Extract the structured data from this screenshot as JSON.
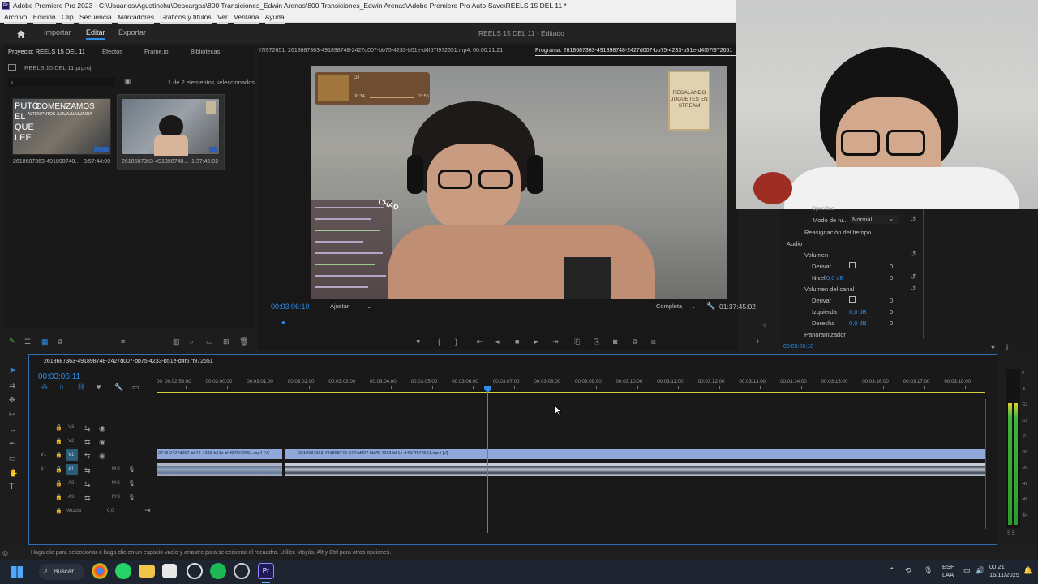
{
  "window": {
    "title": "Adobe Premiere Pro 2023 - C:\\Usuarios\\Agustinchu\\Descargas\\800 Transiciones_Edwin Arenas\\800 Transiciones_Edwin Arenas\\Adobe Premiere Pro Auto-Save\\REELS 15 DEL 11 *",
    "controls": "—"
  },
  "menu": [
    "Archivo",
    "Edición",
    "Clip",
    "Secuencia",
    "Marcadores",
    "Gráficos y títulos",
    "Ver",
    "Ventana",
    "Ayuda"
  ],
  "workspaces": {
    "tabs": [
      "Importar",
      "Editar",
      "Exportar"
    ],
    "active": "Editar",
    "project_title": "REELS 15 DEL 11 - Editado"
  },
  "project": {
    "tabs": [
      "Proyecto: REELS 15 DEL 11",
      "Efectos",
      "Frame.io",
      "Bibliotecas"
    ],
    "file": "REELS 15 DEL 11.prproj",
    "selection": "1 de 2 elementos seleccionados",
    "items": [
      {
        "name": "2618687363-491898748...",
        "duration": "3:57:44:09",
        "overlay": [
          "PUTO",
          "EL",
          "QUE",
          "LEE"
        ],
        "overlay2": "COMENZAMOS",
        "overlay3": "ALTEN PUTOS JUJUAJUAJUAJUA"
      },
      {
        "name": "2618687363-491898748...",
        "duration": "1:37:45:02"
      }
    ]
  },
  "source": {
    "tab": "f7f972651: 2618687363-491898748-2427d007-bb75-4233-b51e-d4f67f972651.mp4: 00:00:21:21"
  },
  "program": {
    "tab": "Programa: 2618687363-491898748-2427d007-bb75-4233-b51e-d4f67f972651",
    "timecode": "00:03:06:10",
    "fit": "Ajustar",
    "quality": "Completa",
    "duration": "01:37:45:02",
    "video_overlays": {
      "chad": "CHAD",
      "giveaway": "REGALANDO JUGUETES EN STREAM",
      "player_time_a": "00:34",
      "player_time_b": "03:55",
      "player_title": "Gil"
    }
  },
  "effect_controls": {
    "mode_label": "Modo de fu...",
    "mode_value": "Normal",
    "opacity_label": "Opacidad",
    "time_remap": "Reasignación del tiempo",
    "audio_label": "Audio",
    "volume": "Volumen",
    "bypass": "Derivar",
    "level": "Nivel",
    "level_value": "0,0 dB",
    "channel_volume": "Volumen del canal",
    "left": "Izquierda",
    "right": "Derecha",
    "left_value": "0,0 dB",
    "right_value": "0,0 dB",
    "panner": "Panoramizador",
    "timecode": "00:03:06:10",
    "zero": "0"
  },
  "timeline": {
    "sequence_name": "2618687363-491898748-2427d007-bb75-4233-b51e-d4f67f972651",
    "timecode": "00:03:06:11",
    "ruler": [
      "00:02:59:00",
      "00:03:00:00",
      "00:03:01:00",
      "00:03:02:00",
      "00:03:03:00",
      "00:03:04:00",
      "00:03:05:00",
      "00:03:06:00",
      "00:03:07:00",
      "00:03:08:00",
      "00:03:09:00",
      "00:03:10:00",
      "00:03:11:00",
      "00:03:12:00",
      "00:03:13:00",
      "00:03:14:00",
      "00:03:15:00",
      "00:03:16:00",
      "00:03:17:00",
      "00:03:18:00"
    ],
    "ruler_start": "00",
    "tracks_video": [
      "V3",
      "V2",
      "V1"
    ],
    "tracks_audio": [
      "A1",
      "A2",
      "A3"
    ],
    "mix": "Mezcla",
    "mix_value": "0,0",
    "clip_left": "2748-2427d007-bb75-4233-b51e-d4f67f972651.mp4 [V]",
    "clip_right": "2618687363-491898748-2427d007-bb75-4233-b51e-d4f67f972651.mp4 [V]",
    "m": "M",
    "s": "S",
    "meter_labels": [
      "0",
      "-6",
      "-12",
      "-18",
      "-24",
      "-30",
      "-36",
      "-42",
      "-48",
      "-54"
    ],
    "meter_ss": "S S"
  },
  "status": "Haga clic para seleccionar o haga clic en un espacio vacío y arrastre para seleccionar el recuadro. Utilice Mayús, Alt y Ctrl para otras opciones.",
  "taskbar": {
    "search": "Buscar",
    "lang_a": "ESP",
    "lang_b": "LAA",
    "time": "00:21",
    "date": "16/11/2025"
  },
  "colors": {
    "accent": "#2d8ceb",
    "audio_clip": "#aeb4c3",
    "video_clip": "#8fa8d9",
    "playhead": "#2d8ceb",
    "yellow": "#d8d03a"
  }
}
